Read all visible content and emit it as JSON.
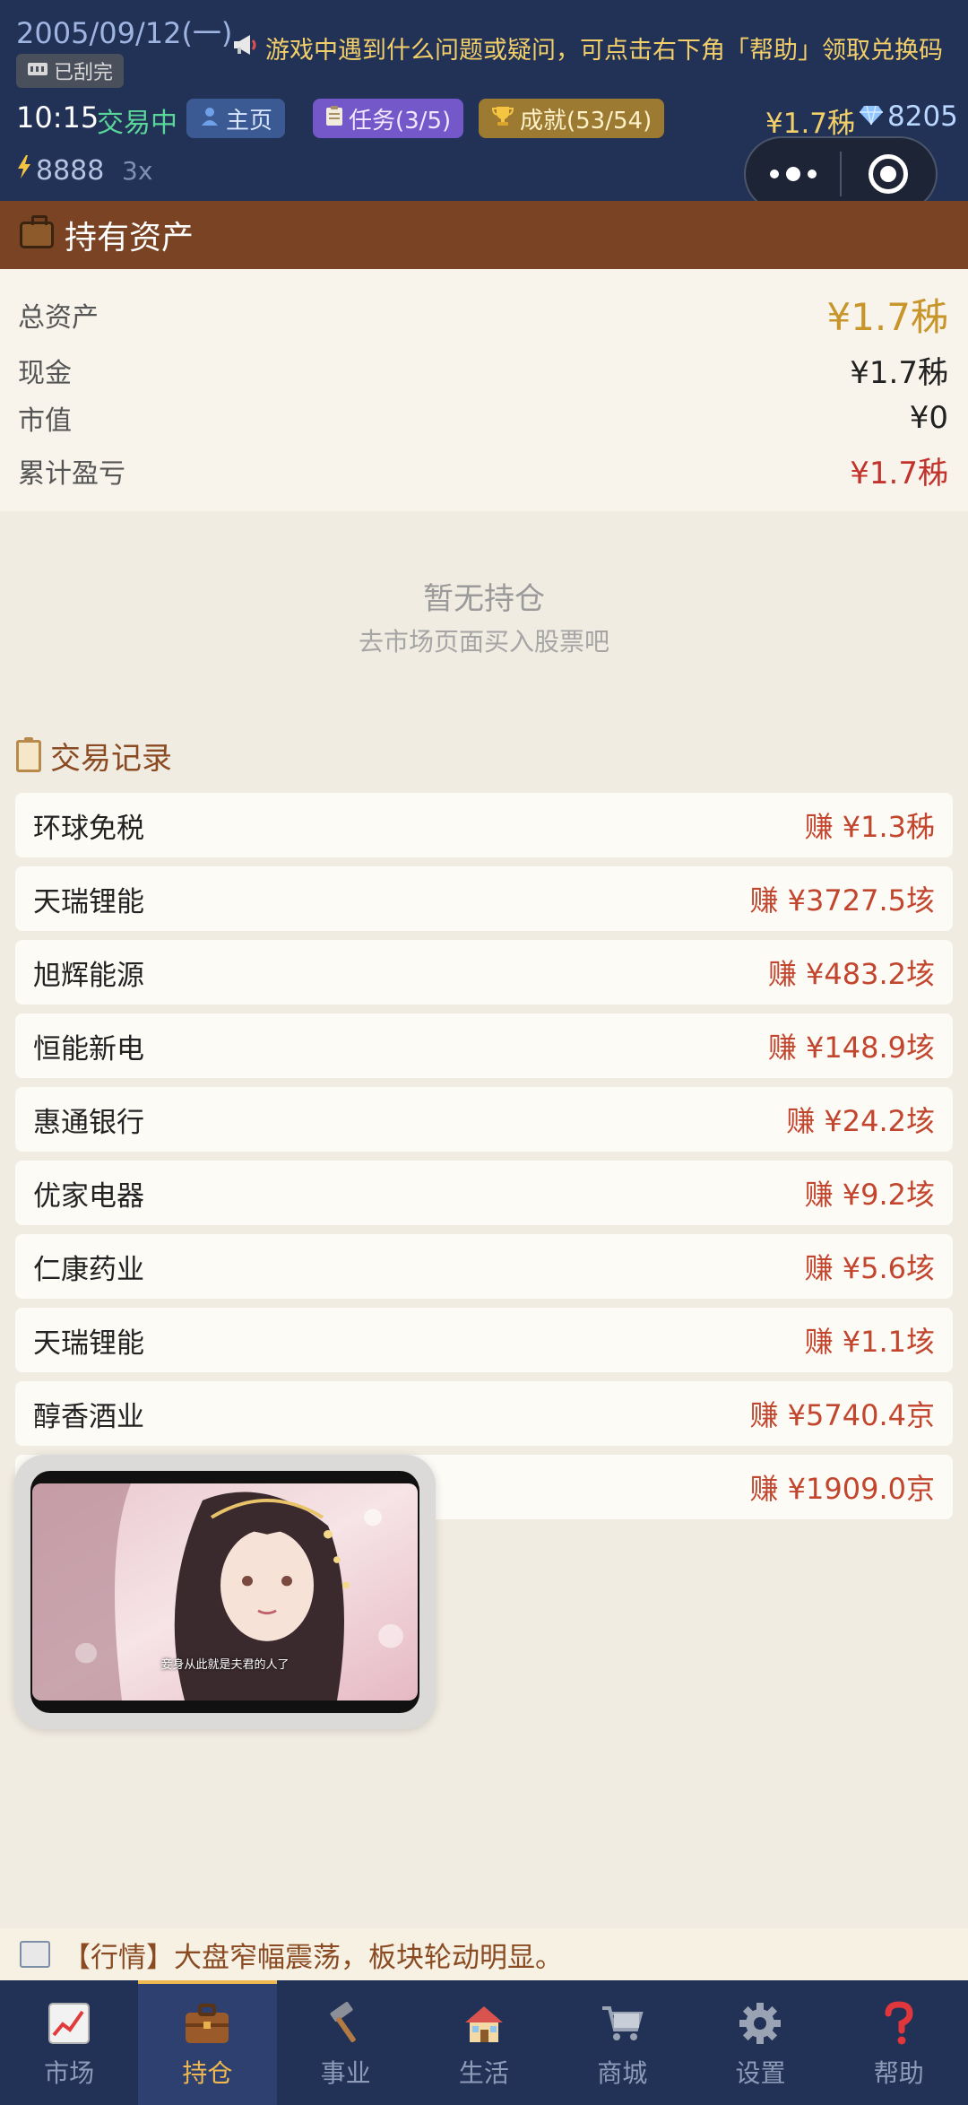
{
  "header": {
    "date": "2005/09/12(一)",
    "scratch_status": "已刮完",
    "announcement": "游戏中遇到什么问题或疑问，可点击右下角「帮助」领取兑换码",
    "time": "10:15",
    "trading_status": "交易中",
    "home_label": "主页",
    "tasks_label": "任务(3/5)",
    "achievements_label": "成就(53/54)",
    "balance": "¥1.7秭",
    "gems": "8205",
    "energy": "8888",
    "multiplier": "3x"
  },
  "section": {
    "title": "持有资产"
  },
  "assets": {
    "total_label": "总资产",
    "total_value": "¥1.7秭",
    "cash_label": "现金",
    "cash_value": "¥1.7秭",
    "market_label": "市值",
    "market_value": "¥0",
    "pnl_label": "累计盈亏",
    "pnl_value": "¥1.7秭"
  },
  "empty": {
    "title": "暂无持仓",
    "subtitle": "去市场页面买入股票吧"
  },
  "records": {
    "title": "交易记录",
    "items": [
      {
        "name": "环球免税",
        "profit": "赚 ¥1.3秭"
      },
      {
        "name": "天瑞锂能",
        "profit": "赚 ¥3727.5垓"
      },
      {
        "name": "旭辉能源",
        "profit": "赚 ¥483.2垓"
      },
      {
        "name": "恒能新电",
        "profit": "赚 ¥148.9垓"
      },
      {
        "name": "惠通银行",
        "profit": "赚 ¥24.2垓"
      },
      {
        "name": "优家电器",
        "profit": "赚 ¥9.2垓"
      },
      {
        "name": "仁康药业",
        "profit": "赚 ¥5.6垓"
      },
      {
        "name": "天瑞锂能",
        "profit": "赚 ¥1.1垓"
      },
      {
        "name": "醇香酒业",
        "profit": "赚 ¥5740.4京"
      },
      {
        "name": "",
        "profit": "赚 ¥1909.0京"
      }
    ]
  },
  "pip": {
    "caption": "妾身从此就是夫君的人了"
  },
  "ticker": {
    "text": "【行情】大盘窄幅震荡，板块轮动明显。"
  },
  "nav": [
    {
      "label": "市场",
      "icon": "chart-icon"
    },
    {
      "label": "持仓",
      "icon": "briefcase-icon"
    },
    {
      "label": "事业",
      "icon": "hammer-icon"
    },
    {
      "label": "生活",
      "icon": "house-icon"
    },
    {
      "label": "商城",
      "icon": "cart-icon"
    },
    {
      "label": "设置",
      "icon": "gear-icon"
    },
    {
      "label": "帮助",
      "icon": "question-icon"
    }
  ],
  "colors": {
    "header_bg": "#223256",
    "section_bar": "#7a4424",
    "gold": "#c8952a",
    "profit_red": "#c2452e",
    "active_nav": "#f0b850"
  }
}
